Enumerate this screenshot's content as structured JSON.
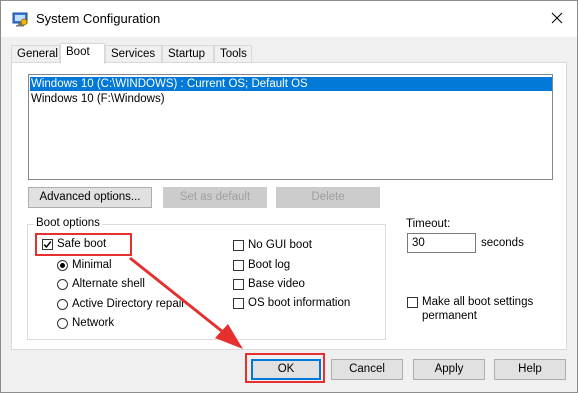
{
  "window": {
    "title": "System Configuration",
    "icon": "system-config-icon",
    "close_icon": "close-icon"
  },
  "tabs": [
    {
      "label": "General",
      "active": false
    },
    {
      "label": "Boot",
      "active": true
    },
    {
      "label": "Services",
      "active": false
    },
    {
      "label": "Startup",
      "active": false
    },
    {
      "label": "Tools",
      "active": false
    }
  ],
  "os_list": [
    {
      "label": "Windows 10 (C:\\WINDOWS) : Current OS; Default OS",
      "selected": true
    },
    {
      "label": "Windows 10 (F:\\Windows)",
      "selected": false
    }
  ],
  "list_buttons": {
    "advanced": "Advanced options...",
    "set_default": "Set as default",
    "delete": "Delete"
  },
  "boot_options": {
    "title": "Boot options",
    "safe_boot": {
      "label": "Safe boot",
      "checked": true
    },
    "modes": [
      {
        "label": "Minimal",
        "selected": true
      },
      {
        "label": "Alternate shell",
        "selected": false
      },
      {
        "label": "Active Directory repair",
        "selected": false
      },
      {
        "label": "Network",
        "selected": false
      }
    ],
    "right": [
      {
        "label": "No GUI boot",
        "checked": false
      },
      {
        "label": "Boot log",
        "checked": false
      },
      {
        "label": "Base video",
        "checked": false
      },
      {
        "label": "OS boot information",
        "checked": false
      }
    ]
  },
  "timeout": {
    "label": "Timeout:",
    "value": "30",
    "unit": "seconds"
  },
  "persist": {
    "label": "Make all boot settings permanent",
    "checked": false
  },
  "dialog_buttons": {
    "ok": "OK",
    "cancel": "Cancel",
    "apply": "Apply",
    "help": "Help"
  },
  "annotation_color": "#e63030",
  "selection_color": "#0078d7"
}
